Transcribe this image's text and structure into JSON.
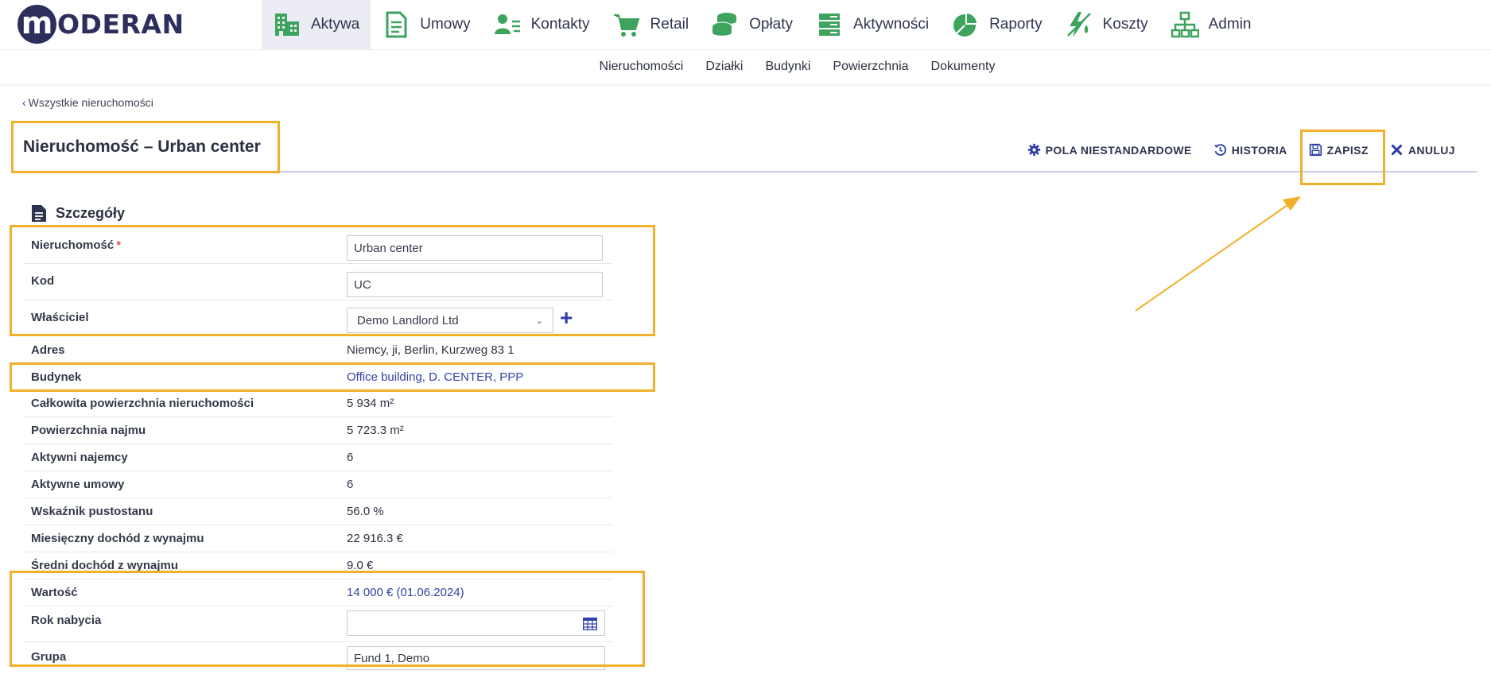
{
  "brand": {
    "letter": "m",
    "name": "ODERAN"
  },
  "nav": {
    "main": [
      {
        "label": "Aktywa",
        "icon": "buildings-icon"
      },
      {
        "label": "Umowy",
        "icon": "document-icon"
      },
      {
        "label": "Kontakty",
        "icon": "contacts-icon"
      },
      {
        "label": "Retail",
        "icon": "cart-icon"
      },
      {
        "label": "Opłaty",
        "icon": "coins-icon"
      },
      {
        "label": "Aktywności",
        "icon": "list-icon"
      },
      {
        "label": "Raporty",
        "icon": "pie-chart-icon"
      },
      {
        "label": "Koszty",
        "icon": "energy-icon"
      },
      {
        "label": "Admin",
        "icon": "sitemap-icon"
      }
    ],
    "sub": [
      "Nieruchomości",
      "Działki",
      "Budynki",
      "Powierzchnia",
      "Dokumenty"
    ]
  },
  "page": {
    "back_label": "Wszystkie nieruchomości",
    "title": "Nieruchomość – Urban center",
    "actions": {
      "custom_fields": "POLA NIESTANDARDOWE",
      "history": "HISTORIA",
      "save": "ZAPISZ",
      "cancel": "ANULUJ"
    }
  },
  "details": {
    "section_title": "Szczegóły",
    "fields": {
      "property_label": "Nieruchomość",
      "property_required": "*",
      "property_value": "Urban center",
      "code_label": "Kod",
      "code_value": "UC",
      "owner_label": "Właściciel",
      "owner_value": "Demo Landlord Ltd",
      "address_label": "Adres",
      "address_value": "Niemcy, ji, Berlin, Kurzweg 83 1",
      "building_label": "Budynek",
      "building_value": "Office building, D. CENTER, PPP",
      "total_area_label": "Całkowita powierzchnia nieruchomości",
      "total_area_value": "5 934 m²",
      "rent_area_label": "Powierzchnia najmu",
      "rent_area_value": "5 723.3 m²",
      "tenants_label": "Aktywni najemcy",
      "tenants_value": "6",
      "contracts_label": "Aktywne umowy",
      "contracts_value": "6",
      "vacancy_label": "Wskaźnik pustostanu",
      "vacancy_value": "56.0 %",
      "monthly_income_label": "Miesięczny dochód z wynajmu",
      "monthly_income_value": "22 916.3 €",
      "avg_income_label": "Średni dochód z wynajmu",
      "avg_income_value": "9.0 €",
      "value_label": "Wartość",
      "value_value": "14 000 € (01.06.2024)",
      "acquisition_year_label": "Rok nabycia",
      "acquisition_year_value": "",
      "group_label": "Grupa",
      "group_value": "Fund 1, Demo"
    }
  },
  "colors": {
    "brand_navy": "#2c2f5b",
    "icon_green": "#3da35d",
    "link_blue": "#3342a0",
    "highlight": "#f0b02a",
    "active_tab_bg": "#ececf4"
  }
}
